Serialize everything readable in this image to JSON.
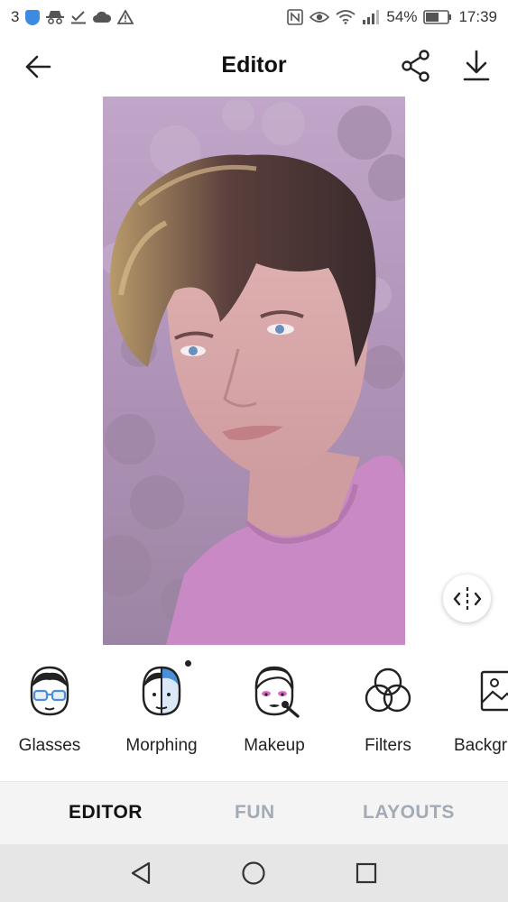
{
  "status_bar": {
    "left_text": "3",
    "battery": "54%",
    "time": "17:39",
    "left_icons": [
      "shield-icon",
      "incognito-icon",
      "check-download-icon",
      "cloud-icon",
      "warning-icon"
    ],
    "right_icons": [
      "nfc-icon",
      "eye-icon",
      "wifi-icon",
      "signal-icon",
      "battery-icon"
    ]
  },
  "header": {
    "title": "Editor",
    "back_icon": "arrow-left-icon",
    "share_icon": "share-icon",
    "download_icon": "download-icon"
  },
  "photo": {
    "compare_icon": "compare-icon"
  },
  "tools": [
    {
      "label": "Glasses",
      "icon": "glasses-face-icon"
    },
    {
      "label": "Morphing",
      "icon": "morphing-face-icon"
    },
    {
      "label": "Makeup",
      "icon": "makeup-face-icon"
    },
    {
      "label": "Filters",
      "icon": "filters-icon"
    },
    {
      "label": "Backgr",
      "icon": "background-image-icon"
    }
  ],
  "tabs": [
    {
      "label": "EDITOR",
      "active": true
    },
    {
      "label": "FUN",
      "active": false
    },
    {
      "label": "LAYOUTS",
      "active": false
    }
  ],
  "system_nav": [
    "back-triangle-icon",
    "home-circle-icon",
    "recents-square-icon"
  ],
  "colors": {
    "accent_blue": "#4a90d9",
    "makeup_pink": "#d86bc4",
    "tab_inactive": "#a3abb4",
    "photo_tint": "#b89ac0"
  }
}
